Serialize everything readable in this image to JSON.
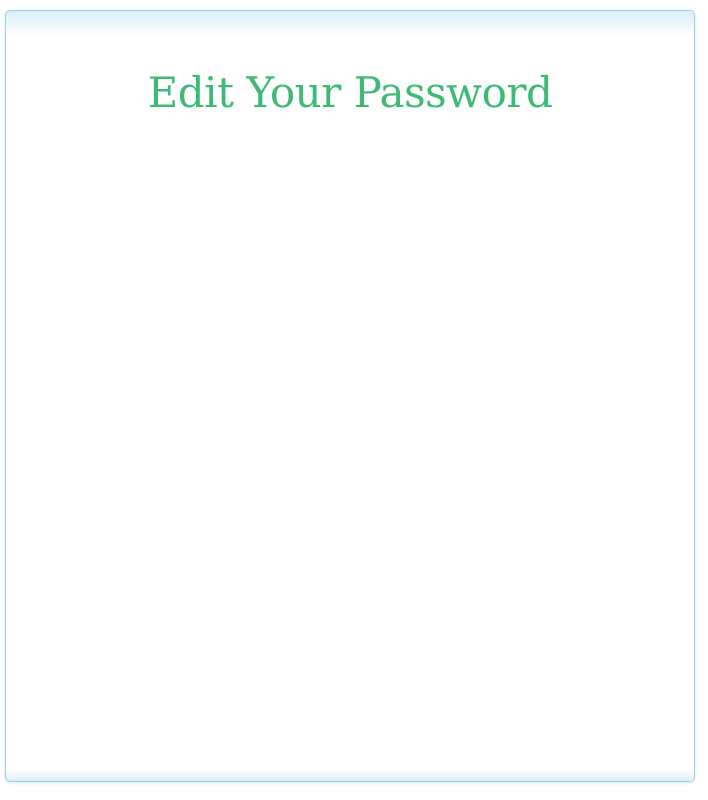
{
  "page": {
    "title": "Edit Your Password"
  },
  "colors": {
    "title": "#3dbb76",
    "panel_border": "#9ccfe2",
    "panel_band": "#d9eef7",
    "background": "#ffffff"
  }
}
